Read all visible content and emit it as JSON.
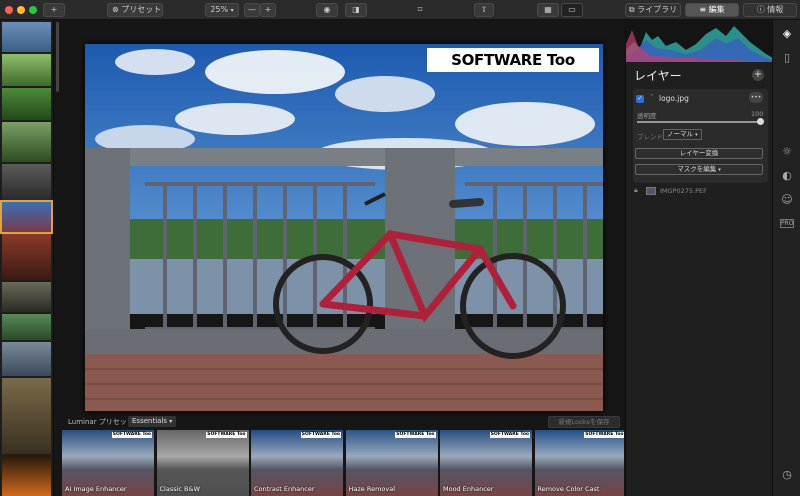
{
  "toolbar": {
    "presets_label": "プリセット",
    "zoom": "25%",
    "zoom_minus": "—",
    "zoom_plus": "+",
    "add": "+",
    "tab_library": "ライブラリ",
    "tab_edit": "編集",
    "tab_info": "情報"
  },
  "photo": {
    "watermark": "SOFTWARE Too"
  },
  "layers": {
    "title": "レイヤー",
    "add": "+",
    "layer_name": "logo.jpg",
    "layer_menu": "•••",
    "opacity_label": "透明度",
    "opacity_value": "100",
    "opacity": 1.0,
    "blend_label": "ブレンド",
    "blend_value": "ノーマル",
    "transform_button": "レイヤー変換",
    "mask_button": "マスクを編集",
    "base_layer": "IMGP0275.PEF"
  },
  "presets_bar": {
    "label": "Luminar プリセット",
    "category": "Essentials",
    "save_button": "新規Looksを保存"
  },
  "presets": [
    {
      "name": "AI Image Enhancer"
    },
    {
      "name": "Classic B&W"
    },
    {
      "name": "Contrast Enhancer"
    },
    {
      "name": "Haze Removal"
    },
    {
      "name": "Mood Enhancer"
    },
    {
      "name": "Remove Color Cast"
    }
  ],
  "preset_watermark": "SOFTWARE Too",
  "right_tools": {
    "pro": "PRO",
    "more": "•••"
  },
  "colors": {
    "accent_red": "#d9322b",
    "panel_bg": "#1f1f1f",
    "topbar_bg": "#2b2b2b"
  }
}
